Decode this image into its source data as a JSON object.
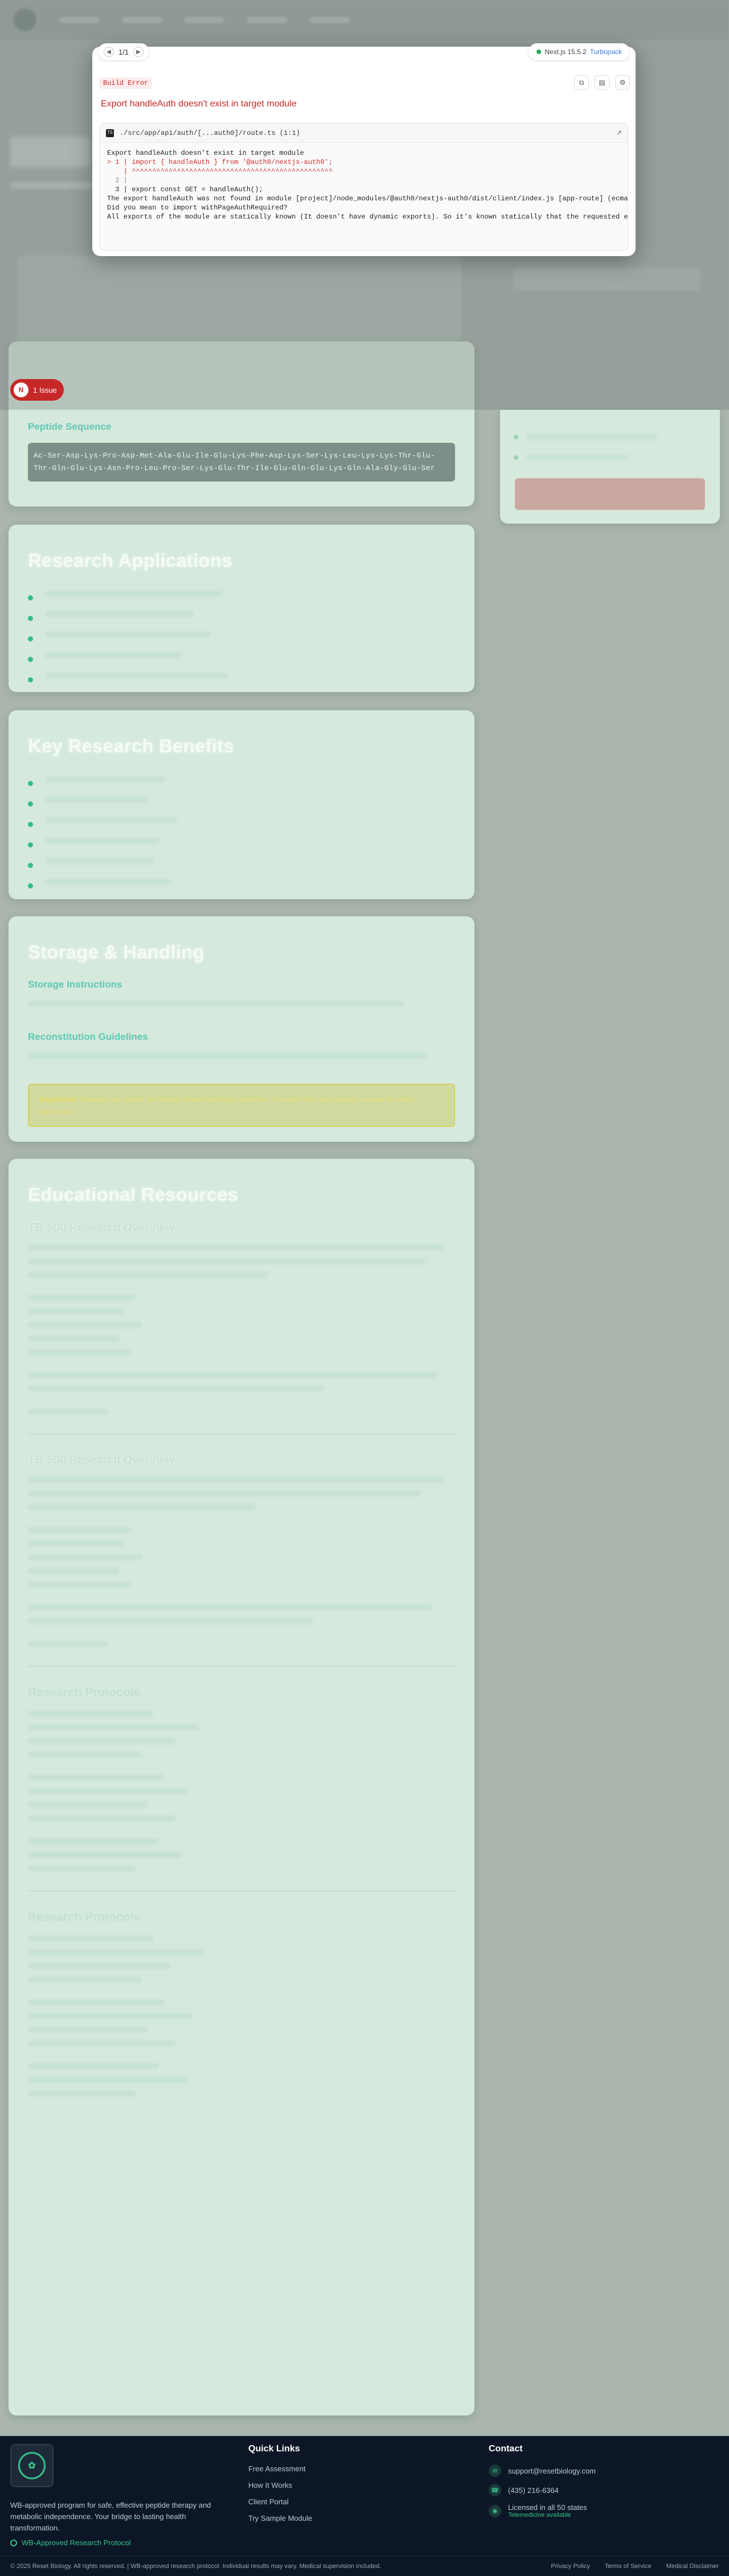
{
  "devtools": {
    "pager": "1/1",
    "version": "Next.js 15.5.2",
    "bundler": "Turbopack",
    "badge": "Build Error",
    "title": "Export handleAuth doesn't exist in target module",
    "file_path": "./src/app/api/auth/[...auth0]/route.ts (1:1)",
    "code_lines": [
      "Export handleAuth doesn't exist in target module",
      "> 1 | import { handleAuth } from '@auth0/nextjs-auth0';",
      "    | ^^^^^^^^^^^^^^^^^^^^^^^^^^^^^^^^^^^^^^^^^^^^^^^^^",
      "  2 |",
      "  3 | export const GET = handleAuth();",
      "",
      "The export handleAuth was not found in module [project]/node_modules/@auth0/nextjs-auth0/dist/client/index.js [app-route] (ecmascript).",
      "Did you mean to import withPageAuthRequired?",
      "All exports of the module are statically known (It doesn't have dynamic exports). So it's known statically that the requested export doesn't exist."
    ],
    "issue_count": "1",
    "issue_label": "1 Issue",
    "issue_icon": "N"
  },
  "peptide": {
    "sequence_heading": "Peptide Sequence",
    "sequence": "Ac-Ser-Asp-Lys-Pro-Asp-Met-Ala-Glu-Ile-Glu-Lys-Phe-Asp-Lys-Ser-Lys-Leu-Lys-Lys-Thr-Glu-Thr-Gln-Glu-Lys-Asn-Pro-Leu-Pro-Ser-Lys-Glu-Thr-Ile-Glu-Gln-Glu-Lys-Gln-Ala-Gly-Glu-Ser"
  },
  "sections": {
    "applications": "Research Applications",
    "benefits": "Key Research Benefits",
    "storage": "Storage & Handling",
    "storage_instructions": "Storage Instructions",
    "reconstitution": "Reconstitution Guidelines",
    "warning_label": "Important:",
    "warning_text": "Always use sterile technique when handling peptides. Consult with appropriate research safety protocols.",
    "education": "Educational Resources",
    "overview_1": "TB-500 Research Overview",
    "overview_2": "TB-500 Research Overview",
    "protocols_1": "Research Protocols",
    "protocols_2": "Research Protocols"
  },
  "footer": {
    "description": "WB-approved program for safe, effective peptide therapy and metabolic independence. Your bridge to lasting health transformation.",
    "badge": "WB-Approved Research Protocol",
    "quick_links_title": "Quick Links",
    "quick_links": [
      "Free Assessment",
      "How It Works",
      "Client Portal",
      "Try Sample Module"
    ],
    "contact_title": "Contact",
    "email": "support@resetbiology.com",
    "phone": "(435) 216-6364",
    "license": "Licensed in all 50 states",
    "telemedicine": "Telemedicine available",
    "copyright": "© 2025 Reset Biology. All rights reserved. | WB-approved research protocol. Individual results may vary. Medical supervision included.",
    "bottom_links": [
      "Privacy Policy",
      "Terms of Service",
      "Medical Disclaimer"
    ]
  }
}
